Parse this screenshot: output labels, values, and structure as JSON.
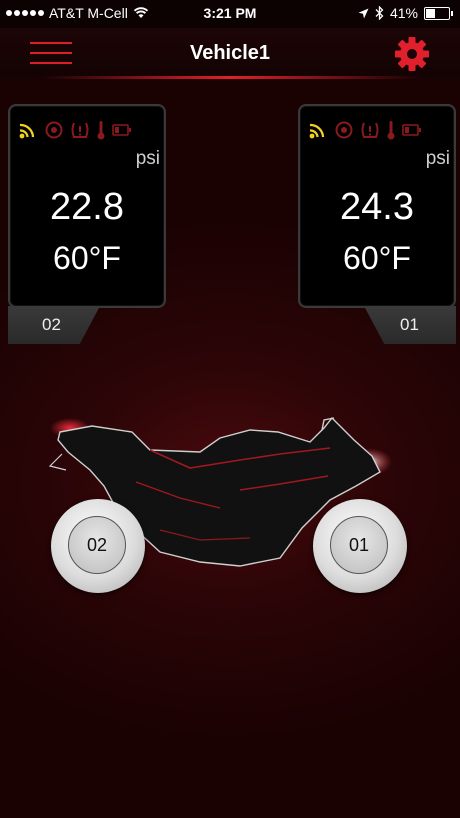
{
  "status_bar": {
    "carrier": "AT&T M-Cell",
    "time": "3:21 PM",
    "battery": "41%",
    "battery_level": 0.41
  },
  "nav": {
    "title": "Vehicle1",
    "menu_icon": "hamburger-menu-icon",
    "settings_icon": "gear-icon",
    "accent_color": "#e0202c"
  },
  "sensors": [
    {
      "id": "02",
      "unit": "psi",
      "pressure": "22.8",
      "temperature": "60°F",
      "icons": [
        "wifi-signal-icon",
        "tire-icon",
        "tire-pressure-warning-icon",
        "thermometer-icon",
        "battery-icon"
      ]
    },
    {
      "id": "01",
      "unit": "psi",
      "pressure": "24.3",
      "temperature": "60°F",
      "icons": [
        "wifi-signal-icon",
        "tire-icon",
        "tire-pressure-warning-icon",
        "thermometer-icon",
        "battery-icon"
      ]
    }
  ],
  "motorcycle": {
    "rear_wheel_label": "02",
    "front_wheel_label": "01"
  },
  "colors": {
    "signal_active": "#f2d21b",
    "icon_inactive": "#8a1a1d",
    "background": "#2c0507"
  }
}
